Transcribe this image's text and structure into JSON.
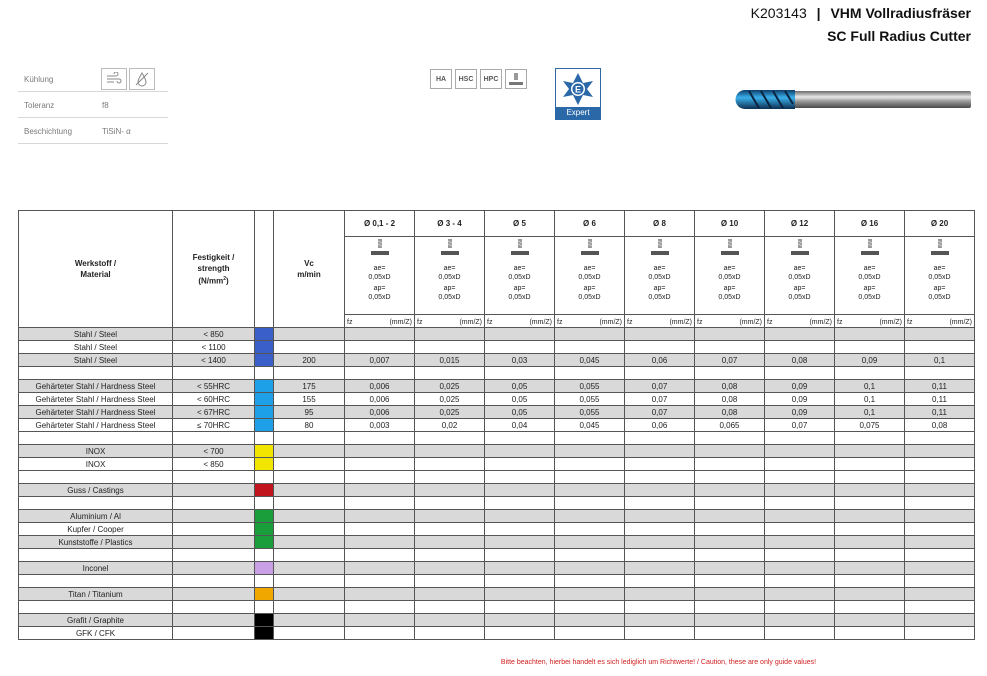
{
  "header": {
    "code": "K203143",
    "separator": "|",
    "title_de": "VHM Vollradiusfräser",
    "title_en": "SC Full Radius Cutter"
  },
  "properties": [
    {
      "key": "Kühlung",
      "value": ""
    },
    {
      "key": "Toleranz",
      "value": "f8"
    },
    {
      "key": "Beschichtung",
      "value": "TiSiN- α"
    }
  ],
  "cooling_icons": [
    "air-cooling-icon",
    "no-coolant-icon"
  ],
  "operations": [
    {
      "label": "HA"
    },
    {
      "label": "HSC"
    },
    {
      "label": "HPC"
    },
    {
      "label": ""
    }
  ],
  "expert_label": "Expert",
  "table": {
    "col_material": "Werkstoff /\nMaterial",
    "col_strength_l1": "Festigkeit /",
    "col_strength_l2": "strength",
    "col_strength_l3": "(N/mm",
    "col_strength_sup": "2",
    "col_strength_l4": ")",
    "col_vc_l1": "Vc",
    "col_vc_l2": "m/min",
    "diameters": [
      "Ø 0,1 - 2",
      "Ø 3 - 4",
      "Ø 5",
      "Ø 6",
      "Ø 8",
      "Ø 10",
      "Ø 12",
      "Ø 16",
      "Ø 20"
    ],
    "ae": "ae=",
    "ae_val": "0,05xD",
    "ap": "ap=",
    "ap_val": "0,05xD",
    "fz": "fz",
    "fz_unit": "(mm/Z)",
    "rows": [
      {
        "gray": true,
        "material": "Stahl / Steel",
        "strength": "< 850",
        "color": "#3a5fc8",
        "vc": "",
        "fz": [
          "",
          "",
          "",
          "",
          "",
          "",
          "",
          "",
          ""
        ]
      },
      {
        "gray": false,
        "material": "Stahl / Steel",
        "strength": "< 1100",
        "color": "#3a5fc8",
        "vc": "",
        "fz": [
          "",
          "",
          "",
          "",
          "",
          "",
          "",
          "",
          ""
        ]
      },
      {
        "gray": true,
        "material": "Stahl / Steel",
        "strength": "< 1400",
        "color": "#3a5fc8",
        "vc": "200",
        "fz": [
          "0,007",
          "0,015",
          "0,03",
          "0,045",
          "0,06",
          "0,07",
          "0,08",
          "0,09",
          "0,1"
        ]
      },
      {
        "gray": false,
        "material": "",
        "strength": "",
        "color": "",
        "vc": "",
        "fz": [
          "",
          "",
          "",
          "",
          "",
          "",
          "",
          "",
          ""
        ]
      },
      {
        "gray": true,
        "material": "Gehärteter Stahl / Hardness Steel",
        "strength": "< 55HRC",
        "color": "#1ea0e8",
        "vc": "175",
        "fz": [
          "0,006",
          "0,025",
          "0,05",
          "0,055",
          "0,07",
          "0,08",
          "0,09",
          "0,1",
          "0,11"
        ]
      },
      {
        "gray": false,
        "material": "Gehärteter Stahl / Hardness Steel",
        "strength": "< 60HRC",
        "color": "#1ea0e8",
        "vc": "155",
        "fz": [
          "0,006",
          "0,025",
          "0,05",
          "0,055",
          "0,07",
          "0,08",
          "0,09",
          "0,1",
          "0,11"
        ]
      },
      {
        "gray": true,
        "material": "Gehärteter Stahl / Hardness Steel",
        "strength": "< 67HRC",
        "color": "#1ea0e8",
        "vc": "95",
        "fz": [
          "0,006",
          "0,025",
          "0,05",
          "0,055",
          "0,07",
          "0,08",
          "0,09",
          "0,1",
          "0,11"
        ]
      },
      {
        "gray": false,
        "material": "Gehärteter Stahl / Hardness Steel",
        "strength": "≤ 70HRC",
        "color": "#1ea0e8",
        "vc": "80",
        "fz": [
          "0,003",
          "0,02",
          "0,04",
          "0,045",
          "0,06",
          "0,065",
          "0,07",
          "0,075",
          "0,08"
        ]
      },
      {
        "gray": false,
        "material": "",
        "strength": "",
        "color": "",
        "vc": "",
        "fz": [
          "",
          "",
          "",
          "",
          "",
          "",
          "",
          "",
          ""
        ]
      },
      {
        "gray": true,
        "material": "INOX",
        "strength": "< 700",
        "color": "#f2e600",
        "vc": "",
        "fz": [
          "",
          "",
          "",
          "",
          "",
          "",
          "",
          "",
          ""
        ]
      },
      {
        "gray": false,
        "material": "INOX",
        "strength": "< 850",
        "color": "#f2e600",
        "vc": "",
        "fz": [
          "",
          "",
          "",
          "",
          "",
          "",
          "",
          "",
          ""
        ]
      },
      {
        "gray": false,
        "material": "",
        "strength": "",
        "color": "",
        "vc": "",
        "fz": [
          "",
          "",
          "",
          "",
          "",
          "",
          "",
          "",
          ""
        ]
      },
      {
        "gray": true,
        "material": "Guss / Castings",
        "strength": "",
        "color": "#c0151c",
        "vc": "",
        "fz": [
          "",
          "",
          "",
          "",
          "",
          "",
          "",
          "",
          ""
        ]
      },
      {
        "gray": false,
        "material": "",
        "strength": "",
        "color": "",
        "vc": "",
        "fz": [
          "",
          "",
          "",
          "",
          "",
          "",
          "",
          "",
          ""
        ]
      },
      {
        "gray": true,
        "material": "Aluminium / Al",
        "strength": "",
        "color": "#1a9e3c",
        "vc": "",
        "fz": [
          "",
          "",
          "",
          "",
          "",
          "",
          "",
          "",
          ""
        ]
      },
      {
        "gray": false,
        "material": "Kupfer / Cooper",
        "strength": "",
        "color": "#1a9e3c",
        "vc": "",
        "fz": [
          "",
          "",
          "",
          "",
          "",
          "",
          "",
          "",
          ""
        ]
      },
      {
        "gray": true,
        "material": "Kunststoffe / Plastics",
        "strength": "",
        "color": "#1a9e3c",
        "vc": "",
        "fz": [
          "",
          "",
          "",
          "",
          "",
          "",
          "",
          "",
          ""
        ]
      },
      {
        "gray": false,
        "material": "",
        "strength": "",
        "color": "",
        "vc": "",
        "fz": [
          "",
          "",
          "",
          "",
          "",
          "",
          "",
          "",
          ""
        ]
      },
      {
        "gray": true,
        "material": "Inconel",
        "strength": "",
        "color": "#c9a0e6",
        "vc": "",
        "fz": [
          "",
          "",
          "",
          "",
          "",
          "",
          "",
          "",
          ""
        ]
      },
      {
        "gray": false,
        "material": "",
        "strength": "",
        "color": "",
        "vc": "",
        "fz": [
          "",
          "",
          "",
          "",
          "",
          "",
          "",
          "",
          ""
        ]
      },
      {
        "gray": true,
        "material": "Titan / Titanium",
        "strength": "",
        "color": "#f0a800",
        "vc": "",
        "fz": [
          "",
          "",
          "",
          "",
          "",
          "",
          "",
          "",
          ""
        ]
      },
      {
        "gray": false,
        "material": "",
        "strength": "",
        "color": "",
        "vc": "",
        "fz": [
          "",
          "",
          "",
          "",
          "",
          "",
          "",
          "",
          ""
        ]
      },
      {
        "gray": true,
        "material": "Grafit / Graphite",
        "strength": "",
        "color": "#000000",
        "vc": "",
        "fz": [
          "",
          "",
          "",
          "",
          "",
          "",
          "",
          "",
          ""
        ]
      },
      {
        "gray": false,
        "material": "GFK / CFK",
        "strength": "",
        "color": "#000000",
        "vc": "",
        "fz": [
          "",
          "",
          "",
          "",
          "",
          "",
          "",
          "",
          ""
        ]
      }
    ]
  },
  "footer_note": "Bitte beachten, hierbei handelt es sich lediglich um Richtwerte!  /  Caution, these are only guide values!"
}
